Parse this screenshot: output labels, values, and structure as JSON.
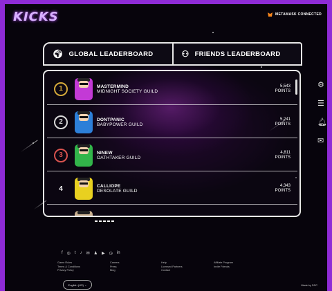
{
  "app": {
    "logo_text": "KICKS",
    "wallet_status": "METAMASK CONNECTED"
  },
  "tabs": [
    {
      "label": "GLOBAL LEADERBOARD",
      "icon": "globe-icon"
    },
    {
      "label": "FRIENDS LEADERBOARD",
      "icon": "people-icon"
    }
  ],
  "leaderboard": [
    {
      "rank": "1",
      "name": "MASTERMIND",
      "guild": "MIDNIGHT SOCIETY GUILD",
      "points": "5,543",
      "points_label": "POINTS",
      "medal_color": "#d4a93a",
      "avatar_color": "#c33ad6"
    },
    {
      "rank": "2",
      "name": "DONTPANIC",
      "guild": "BABYPOWER GUILD",
      "points": "5,241",
      "points_label": "POINTS",
      "medal_color": "#d9d9d9",
      "avatar_color": "#2d7fd8"
    },
    {
      "rank": "3",
      "name": "NINEW",
      "guild": "OATHTAKER GUILD",
      "points": "4,811",
      "points_label": "POINTS",
      "medal_color": "#d9534f",
      "avatar_color": "#32b54a"
    },
    {
      "rank": "4",
      "name": "CALLIOPE",
      "guild": "DESOLATE GUILD",
      "points": "4,343",
      "points_label": "POINTS",
      "medal_color": "",
      "avatar_color": "#e8d020"
    }
  ],
  "side_icons": [
    "gear-icon",
    "list-icon",
    "bell-icon",
    "mail-icon"
  ],
  "footer": {
    "social_icons": [
      "f",
      "◎",
      "t",
      "♪",
      "✉",
      "♟",
      "▶",
      "◷",
      "in"
    ],
    "col1": [
      "Game Rules",
      "Terms & Conditions",
      "Privacy Policy"
    ],
    "col2": [
      "Careers",
      "Press",
      "Blog"
    ],
    "col3": [
      "Help",
      "Licensed Partners",
      "Contact"
    ],
    "col4": [
      "Affiliate Program",
      "Invite Friends"
    ],
    "language": "English (US)",
    "made_by": "Made by DSC"
  }
}
